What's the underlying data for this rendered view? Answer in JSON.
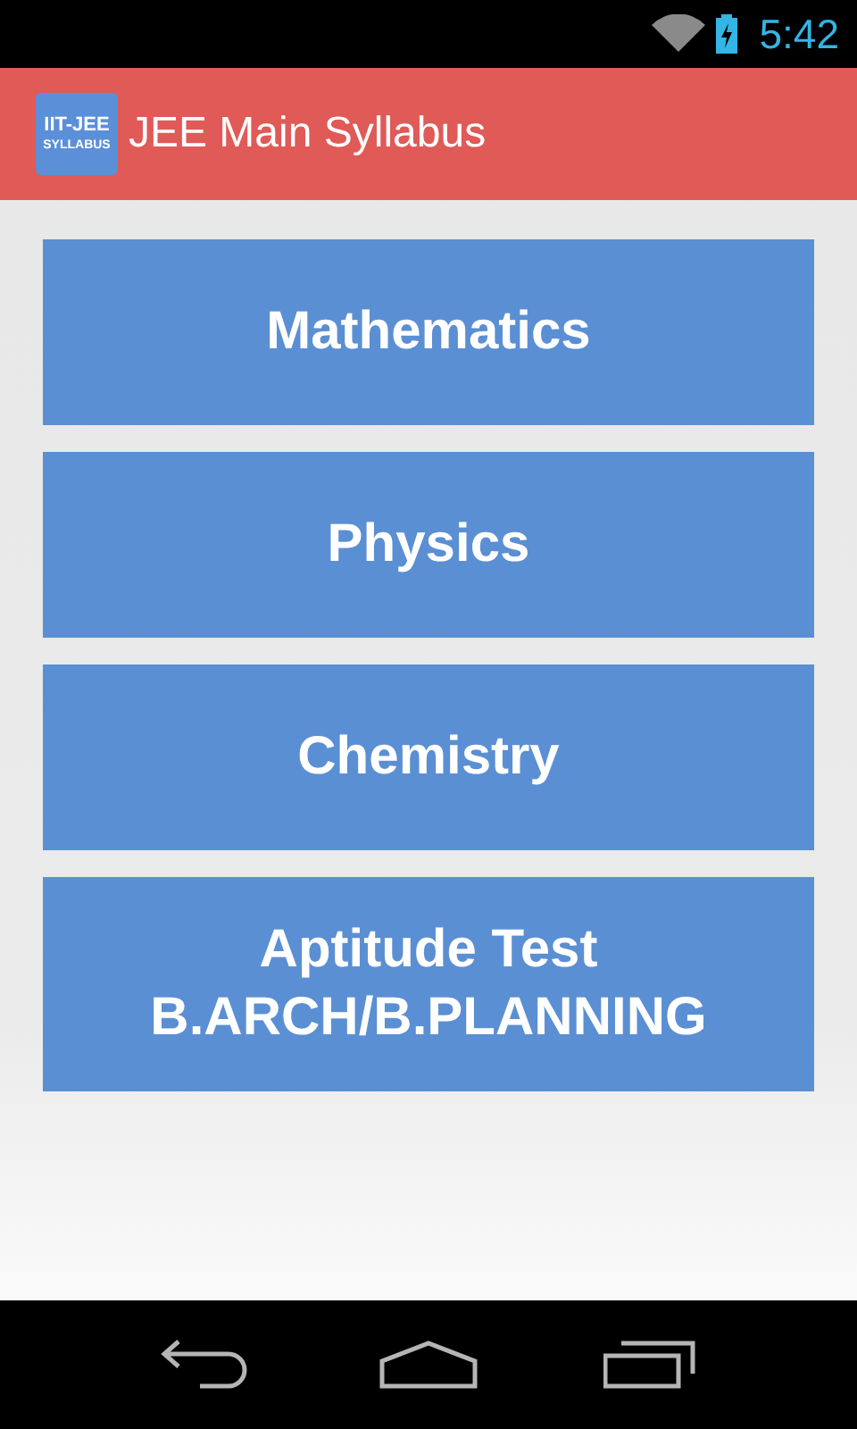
{
  "status_bar": {
    "time": "5:42"
  },
  "action_bar": {
    "logo_lines": [
      "IIT-JEE",
      "SYLLABUS"
    ],
    "title": "JEE Main Syllabus"
  },
  "subjects": [
    {
      "lines": [
        "Mathematics"
      ]
    },
    {
      "lines": [
        "Physics"
      ]
    },
    {
      "lines": [
        "Chemistry"
      ]
    },
    {
      "lines": [
        "Aptitude Test",
        "B.ARCH/B.PLANNING"
      ]
    }
  ]
}
